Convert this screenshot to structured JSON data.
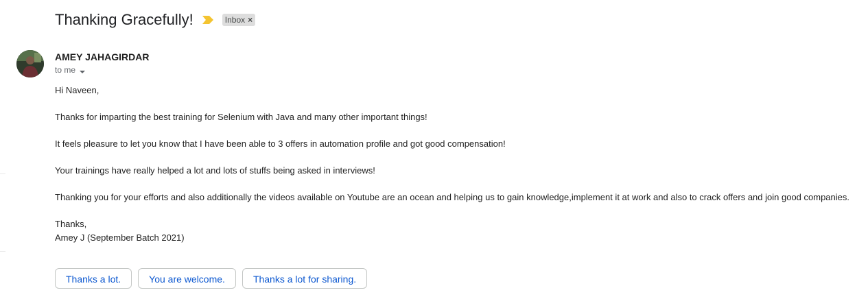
{
  "email": {
    "subject": "Thanking Gracefully!",
    "importance_icon": "importance-marker-icon",
    "label": "Inbox",
    "label_close": "×",
    "sender": "AMEY JAHAGIRDAR",
    "recipient": "to me",
    "body": [
      "Hi Naveen,",
      "Thanks for imparting the best training for Selenium with Java and many other important things!",
      "It feels pleasure to let you know that I have been able to 3 offers in automation profile and got good compensation!",
      "Your trainings have really helped a lot and lots of stuffs being asked in interviews!",
      "Thanking you for your efforts and also additionally the videos available on Youtube are an ocean and helping us to gain knowledge,implement it at work and also to crack offers and join good companies.",
      "Thanks,",
      "Amey J (September Batch 2021)"
    ]
  },
  "smart_replies": [
    "Thanks a lot.",
    "You are welcome.",
    "Thanks a lot for sharing."
  ],
  "colors": {
    "importance": "#f4c430",
    "chip_bg": "#dddddd",
    "reply_text": "#0b57d0"
  }
}
